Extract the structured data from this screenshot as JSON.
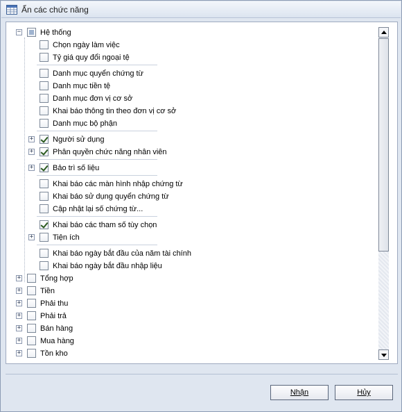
{
  "window": {
    "title": "Ẩn các chức năng",
    "icon": "table-window-icon"
  },
  "tree": {
    "root": {
      "label": "Hệ thống",
      "state": "indeterminate",
      "expanded": true
    },
    "children": [
      {
        "label": "Chọn ngày làm việc",
        "checked": false
      },
      {
        "label": "Tỷ giá quy đổi ngoại tệ",
        "checked": false
      },
      {
        "label": "Danh mục quyển chứng từ",
        "checked": false
      },
      {
        "label": "Danh mục tiền tệ",
        "checked": false
      },
      {
        "label": "Danh mục đơn vị cơ sở",
        "checked": false
      },
      {
        "label": "Khai báo thông tin theo đơn vị cơ sở",
        "checked": false
      },
      {
        "label": "Danh mục bộ phận",
        "checked": false
      },
      {
        "label": "Người sử dụng",
        "checked": true,
        "expandable": true
      },
      {
        "label": "Phân quyền chức năng nhân viên",
        "checked": true,
        "expandable": true
      },
      {
        "label": "Bảo trì số liệu",
        "checked": true,
        "expandable": true
      },
      {
        "label": "Khai báo các màn hình nhập chứng từ",
        "checked": false
      },
      {
        "label": "Khai báo sử dụng quyển chứng từ",
        "checked": false
      },
      {
        "label": "Cập nhật lại số chứng từ...",
        "checked": false
      },
      {
        "label": "Khai báo các tham số tùy chọn",
        "checked": true
      },
      {
        "label": "Tiện ích",
        "checked": false,
        "expandable": true
      },
      {
        "label": "Khai báo ngày bắt đầu của năm tài chính",
        "checked": false
      },
      {
        "label": "Khai báo ngày bắt đầu nhập liệu",
        "checked": false
      }
    ],
    "top_level": [
      {
        "label": "Tổng hợp",
        "checked": false
      },
      {
        "label": "Tiền",
        "checked": false
      },
      {
        "label": "Phải thu",
        "checked": false
      },
      {
        "label": "Phải trả",
        "checked": false
      },
      {
        "label": "Bán hàng",
        "checked": false
      },
      {
        "label": "Mua hàng",
        "checked": false
      },
      {
        "label": "Tồn kho",
        "checked": false
      }
    ]
  },
  "buttons": {
    "ok": {
      "label": "Nhận"
    },
    "cancel": {
      "label": "Hủy"
    }
  }
}
